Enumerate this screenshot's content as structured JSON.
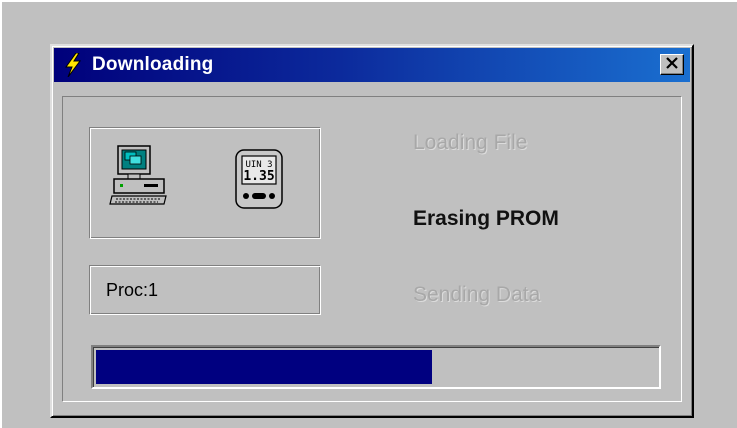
{
  "window": {
    "title": "Downloading",
    "title_icon": "lightning-bolt-icon",
    "close_icon": "close-icon",
    "title_bar_color_start": "#00007b",
    "title_bar_color_end": "#1a6fd0"
  },
  "icons": {
    "computer": "computer-icon",
    "device": "device-icon",
    "device_screen_line1": "UIN 3",
    "device_screen_line2": "1.35"
  },
  "proc": {
    "label": "Proc:1"
  },
  "steps": [
    {
      "label": "Loading File",
      "state": "disabled"
    },
    {
      "label": "Erasing PROM",
      "state": "active"
    },
    {
      "label": "Sending Data",
      "state": "disabled"
    }
  ],
  "progress": {
    "value_percent": 60,
    "fill_color": "#000080"
  }
}
